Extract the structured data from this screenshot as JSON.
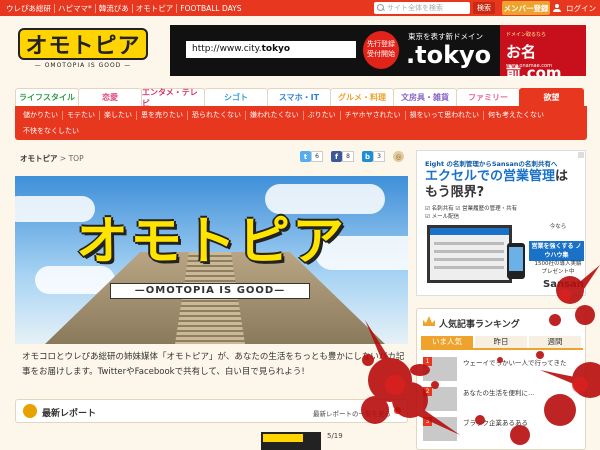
{
  "topbar": {
    "links": [
      "ウレぴあ総研",
      "ハピママ*",
      "韓流ぴあ",
      "オモトピア",
      "FOOTBALL DAYS"
    ],
    "search_placeholder": "サイト全体を検索",
    "search_button": "検索",
    "member_button": "メンバー登録",
    "login": "ログイン"
  },
  "logo": {
    "word": "オモトピア",
    "tagline": "— OMOTOPIA IS GOOD —"
  },
  "banner": {
    "url_prefix": "http://www.city.",
    "url_domain": "tokyo",
    "badge": "先行登録\n受付開始",
    "headline": "東京を表す新ドメイン",
    "tld": ".tokyo",
    "sponsor_small": "ドメイン取るなら",
    "sponsor_big": "お名前.com",
    "sponsor_url": "www.onamae.com"
  },
  "categories": [
    {
      "label": "ライフスタイル",
      "color": "#2f9b45"
    },
    {
      "label": "恋愛",
      "color": "#e14f7a"
    },
    {
      "label": "エンタメ・テレビ",
      "color": "#d2376b"
    },
    {
      "label": "シゴト",
      "color": "#2e9fd6"
    },
    {
      "label": "スマホ・IT",
      "color": "#2e7fd6"
    },
    {
      "label": "グルメ・料理",
      "color": "#f0a32c"
    },
    {
      "label": "文房具・雑貨",
      "color": "#8a63c6"
    },
    {
      "label": "ファミリー",
      "color": "#e8628a"
    },
    {
      "label": "欲望",
      "color": "#ffffff"
    }
  ],
  "subnav": {
    "row1": [
      "儲かりたい",
      "モテたい",
      "楽したい",
      "恩を売りたい",
      "恐られたくない",
      "嫌われたくない",
      "ぶりたい",
      "チヤホヤされたい",
      "損をいって思われたい",
      "何も考えたくない"
    ],
    "row2": [
      "不快をなくしたい"
    ]
  },
  "breadcrumb": {
    "home": "オモトピア",
    "sep": ">",
    "current": "TOP"
  },
  "shares": [
    {
      "icon": "t",
      "count": "6",
      "color": "#55acee"
    },
    {
      "icon": "f",
      "count": "8",
      "color": "#3b5998"
    },
    {
      "icon": "b",
      "count": "3",
      "color": "#1d8fd8"
    }
  ],
  "hero": {
    "title": "オモトピア",
    "subtitle": "—OMOTOPIA IS GOOD—"
  },
  "intro": "オモコロとウレぴあ総研の姉妹媒体「オモトピア」が、あなたの生活をちっとも豊かにしないバカ記事をお届けします。TwitterやFacebookで共有して、白い目で見られよう!",
  "latest": {
    "heading": "最新レポート",
    "more": "最新レポートの一覧を見る"
  },
  "card": {
    "date": "5/19"
  },
  "ad": {
    "logo": "Eight の名刺管理からSansanの名刺共有へ",
    "headline_1": "エクセルでの",
    "headline_2": "営業管理",
    "headline_3": "は",
    "headline_4": "もう限界?",
    "checks": [
      "☑ 名刺共有  ☑ 営業履歴の管理・共有",
      "☑ メール配信"
    ],
    "r1": "今なら",
    "r2": "営業を強くする ノウハウ集",
    "r3": "プレゼント中",
    "r4_count": "1500社の導入実績",
    "r4": "Sansan"
  },
  "ranking": {
    "heading": "人気記事ランキング",
    "tabs": [
      "いま人気",
      "昨日",
      "週間"
    ],
    "items": [
      "ウェーイでっかい一人で行ってきた",
      "あなたの生活を便利に…",
      "ブラック企業あるある"
    ]
  }
}
